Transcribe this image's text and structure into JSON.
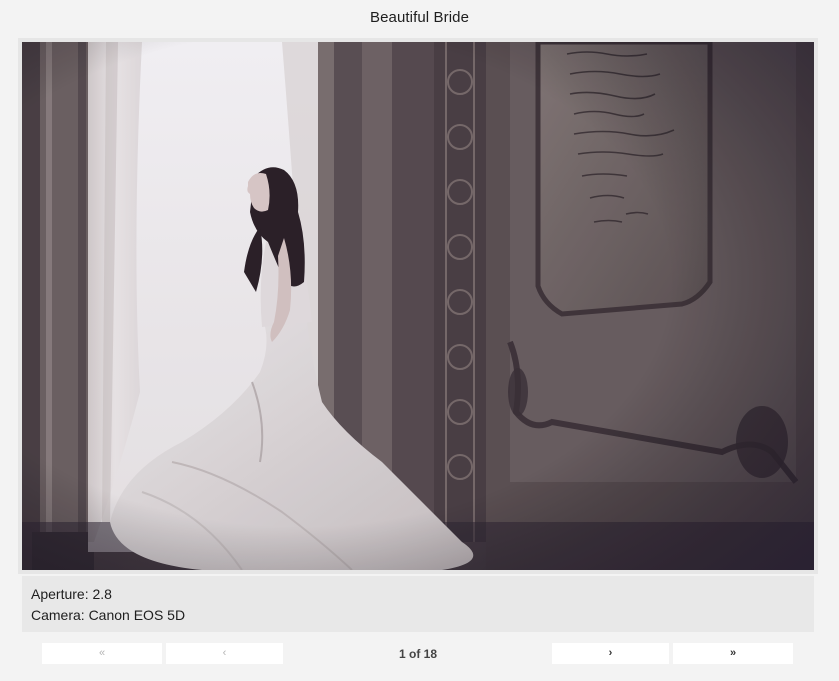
{
  "gallery": {
    "title": "Beautiful Bride"
  },
  "photo": {
    "alt": "Bride in white gown standing by a bright window in an ornate room"
  },
  "details": {
    "aperture": "Aperture: 2.8",
    "camera": "Camera: Canon EOS 5D"
  },
  "pagination": {
    "first_label": "«",
    "prev_label": "‹",
    "indicator": "1 of 18",
    "next_label": "›",
    "last_label": "»",
    "current_page": 1,
    "total_pages": 18
  }
}
